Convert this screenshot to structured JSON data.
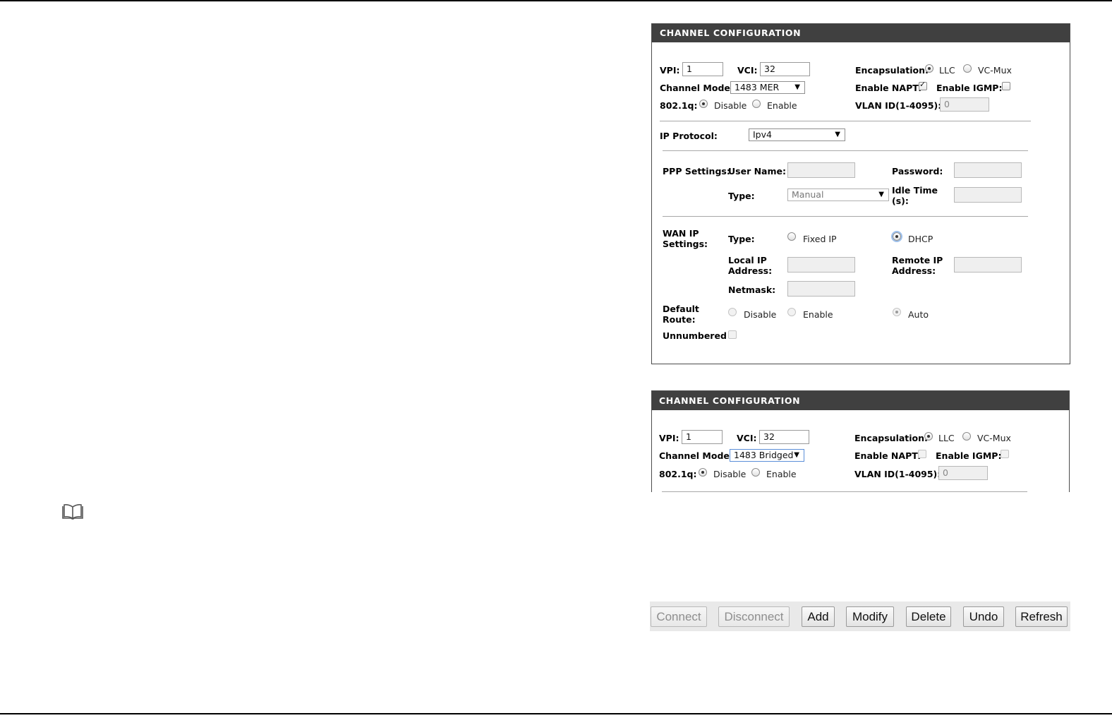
{
  "panel1": {
    "title": "CHANNEL CONFIGURATION",
    "vpi_label": "VPI:",
    "vpi_value": "1",
    "vci_label": "VCI:",
    "vci_value": "32",
    "encapsulation_label": "Encapsulation:",
    "encapsulation_options": [
      "LLC",
      "VC-Mux"
    ],
    "encapsulation_selected": "LLC",
    "channel_mode_label": "Channel Mode:",
    "channel_mode_value": "1483 MER",
    "enable_napt_label": "Enable NAPT:",
    "enable_napt_checked": true,
    "enable_igmp_label": "Enable IGMP:",
    "enable_igmp_checked": false,
    "dot1q_label": "802.1q:",
    "dot1q_options": [
      "Disable",
      "Enable"
    ],
    "dot1q_selected": "Disable",
    "vlan_label": "VLAN ID(1-4095):",
    "vlan_value": "0",
    "ip_protocol_label": "IP Protocol:",
    "ip_protocol_value": "Ipv4",
    "ppp_settings_label": "PPP Settings:",
    "user_name_label": "User Name:",
    "password_label": "Password:",
    "type_label": "Type:",
    "ppp_type_value": "Manual",
    "idle_time_label_1": "Idle Time",
    "idle_time_label_2": "(s):",
    "wan_ip_label_1": "WAN IP",
    "wan_ip_label_2": "Settings:",
    "wan_type_label": "Type:",
    "wan_type_options": [
      "Fixed IP",
      "DHCP"
    ],
    "wan_type_selected": "DHCP",
    "local_ip_label_1": "Local IP",
    "local_ip_label_2": "Address:",
    "remote_ip_label_1": "Remote IP",
    "remote_ip_label_2": "Address:",
    "netmask_label": "Netmask:",
    "default_route_label_1": "Default",
    "default_route_label_2": "Route:",
    "default_route_options": [
      "Disable",
      "Enable",
      "Auto"
    ],
    "default_route_selected": "Auto",
    "unnumbered_label": "Unnumbered"
  },
  "panel2": {
    "title": "CHANNEL CONFIGURATION",
    "vpi_label": "VPI:",
    "vpi_value": "1",
    "vci_label": "VCI:",
    "vci_value": "32",
    "encapsulation_label": "Encapsulation:",
    "encapsulation_options": [
      "LLC",
      "VC-Mux"
    ],
    "encapsulation_selected": "LLC",
    "channel_mode_label": "Channel Mode:",
    "channel_mode_value": "1483 Bridged",
    "enable_napt_label": "Enable NAPT:",
    "enable_napt_checked": false,
    "enable_igmp_label": "Enable IGMP:",
    "enable_igmp_checked": false,
    "dot1q_label": "802.1q:",
    "dot1q_options": [
      "Disable",
      "Enable"
    ],
    "dot1q_selected": "Disable",
    "vlan_label": "VLAN ID(1-4095):",
    "vlan_value": "0"
  },
  "buttons": {
    "connect": "Connect",
    "disconnect": "Disconnect",
    "add": "Add",
    "modify": "Modify",
    "delete": "Delete",
    "undo": "Undo",
    "refresh": "Refresh"
  }
}
